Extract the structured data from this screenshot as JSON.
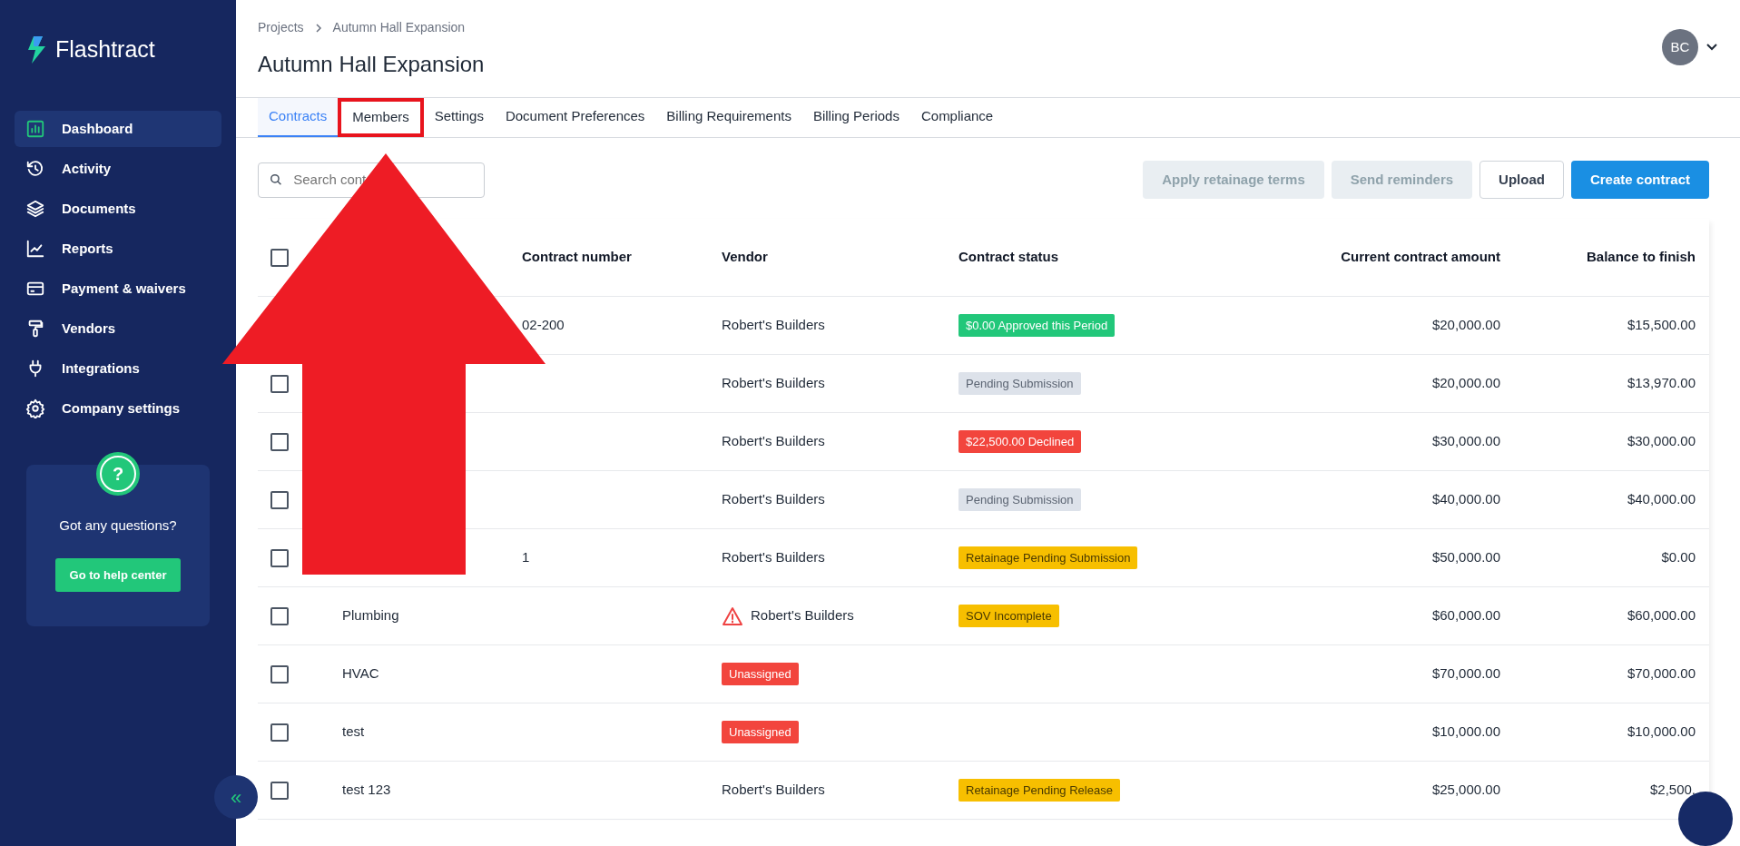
{
  "brand": {
    "name": "Flashtract"
  },
  "sidebar": {
    "items": [
      {
        "label": "Dashboard",
        "selected": true
      },
      {
        "label": "Activity",
        "selected": false
      },
      {
        "label": "Documents",
        "selected": false
      },
      {
        "label": "Reports",
        "selected": false
      },
      {
        "label": "Payment & waivers",
        "selected": false
      },
      {
        "label": "Vendors",
        "selected": false
      },
      {
        "label": "Integrations",
        "selected": false
      },
      {
        "label": "Company settings",
        "selected": false
      }
    ],
    "help": {
      "icon_text": "?",
      "text": "Got any questions?",
      "button": "Go to help center"
    },
    "collapse": "«"
  },
  "breadcrumb": [
    "Projects",
    "Autumn Hall Expansion"
  ],
  "title": "Autumn Hall Expansion",
  "user": {
    "initials": "BC"
  },
  "tabs": [
    {
      "label": "Contracts",
      "selected": true,
      "highlighted": false
    },
    {
      "label": "Members",
      "selected": false,
      "highlighted": true
    },
    {
      "label": "Settings",
      "selected": false,
      "highlighted": false
    },
    {
      "label": "Document Preferences",
      "selected": false,
      "highlighted": false
    },
    {
      "label": "Billing Requirements",
      "selected": false,
      "highlighted": false
    },
    {
      "label": "Billing Periods",
      "selected": false,
      "highlighted": false
    },
    {
      "label": "Compliance",
      "selected": false,
      "highlighted": false
    }
  ],
  "search": {
    "placeholder": "Search cont"
  },
  "actions": [
    {
      "label": "Apply retainage terms",
      "kind": "disabled"
    },
    {
      "label": "Send reminders",
      "kind": "disabled"
    },
    {
      "label": "Upload",
      "kind": "outline"
    },
    {
      "label": "Create contract",
      "kind": "primary"
    }
  ],
  "table": {
    "header_checked": false,
    "columns": [
      "Contract number",
      "Vendor",
      "Contract status",
      "Current contract amount",
      "Balance to finish"
    ],
    "rows": [
      {
        "contract_number": "02-200",
        "vendor": {
          "text": "Robert's Builders",
          "kind": "plain",
          "warning": false
        },
        "status": {
          "text": "$0.00 Approved this Period",
          "kind": "success"
        },
        "amount": "$20,000.00",
        "balance": "$15,500.00"
      },
      {
        "checked": false,
        "vendor": {
          "text": "Robert's Builders",
          "kind": "plain",
          "warning": false
        },
        "status": {
          "text": "Pending Submission",
          "kind": "muted"
        },
        "amount": "$20,000.00",
        "balance": "$13,970.00"
      },
      {
        "checked": false,
        "vendor": {
          "text": "Robert's Builders",
          "kind": "plain",
          "warning": false
        },
        "status": {
          "text": "$22,500.00 Declined",
          "kind": "danger"
        },
        "amount": "$30,000.00",
        "balance": "$30,000.00"
      },
      {
        "checked": false,
        "vendor": {
          "text": "Robert's Builders",
          "kind": "plain",
          "warning": false
        },
        "status": {
          "text": "Pending Submission",
          "kind": "muted"
        },
        "amount": "$40,000.00",
        "balance": "$40,000.00"
      },
      {
        "checked": false,
        "contract_number": "1",
        "vendor": {
          "text": "Robert's Builders",
          "kind": "plain",
          "warning": false
        },
        "status": {
          "text": "Retainage Pending Submission",
          "kind": "warning"
        },
        "amount": "$50,000.00",
        "balance": "$0.00"
      },
      {
        "checked": false,
        "name": "Plumbing",
        "vendor": {
          "text": "Robert's Builders",
          "kind": "plain",
          "warning": true
        },
        "status": {
          "text": "SOV Incomplete",
          "kind": "warning"
        },
        "amount": "$60,000.00",
        "balance": "$60,000.00"
      },
      {
        "checked": false,
        "name": "HVAC",
        "vendor": {
          "text": "Unassigned",
          "kind": "danger",
          "warning": false
        },
        "amount": "$70,000.00",
        "balance": "$70,000.00"
      },
      {
        "checked": false,
        "name": "test",
        "vendor": {
          "text": "Unassigned",
          "kind": "danger",
          "warning": false
        },
        "amount": "$10,000.00",
        "balance": "$10,000.00"
      },
      {
        "checked": false,
        "name": "test 123",
        "vendor": {
          "text": "Robert's Builders",
          "kind": "plain",
          "warning": false
        },
        "status": {
          "text": "Retainage Pending Release",
          "kind": "warning"
        },
        "amount": "$25,000.00",
        "balance": "$2,500."
      }
    ]
  }
}
